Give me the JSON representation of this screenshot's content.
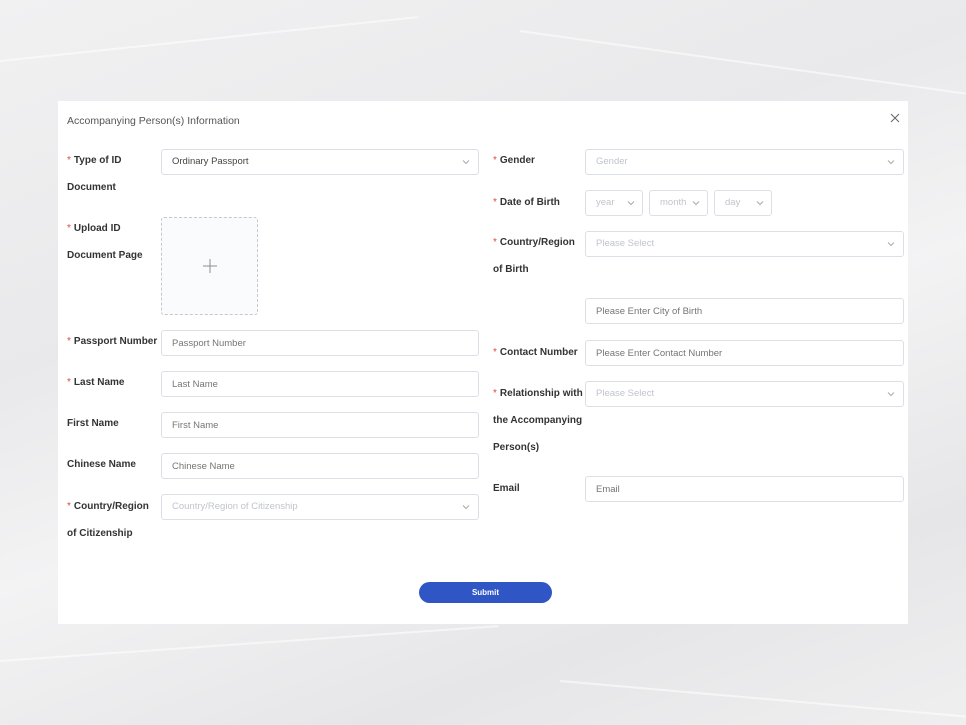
{
  "dialog": {
    "title": "Accompanying Person(s) Information",
    "close_icon": "close-icon"
  },
  "left": {
    "id_type": {
      "label_l1": "Type of ID",
      "label_l2": "Document",
      "value": "Ordinary Passport"
    },
    "upload": {
      "label_l1": "Upload ID",
      "label_l2": "Document Page",
      "icon": "plus-icon"
    },
    "passport_number": {
      "label": "Passport Number",
      "placeholder": "Passport Number"
    },
    "last_name": {
      "label": "Last Name",
      "placeholder": "Last Name"
    },
    "first_name": {
      "label": "First Name",
      "placeholder": "First Name"
    },
    "chinese_name": {
      "label": "Chinese Name",
      "placeholder": "Chinese Name"
    },
    "citizenship": {
      "label_l1": "Country/Region",
      "label_l2": "of Citizenship",
      "placeholder": "Country/Region of Citizenship"
    }
  },
  "right": {
    "gender": {
      "label": "Gender",
      "placeholder": "Gender"
    },
    "dob": {
      "label": "Date of Birth",
      "year": "year",
      "month": "month",
      "day": "day"
    },
    "birth_country": {
      "label_l1": "Country/Region",
      "label_l2": "of Birth",
      "placeholder": "Please Select"
    },
    "birth_city": {
      "placeholder": "Please Enter City of Birth"
    },
    "contact": {
      "label": "Contact Number",
      "placeholder": "Please Enter Contact Number"
    },
    "relationship": {
      "label_l1": "Relationship with",
      "label_l2": "the Accompanying",
      "label_l3": "Person(s)",
      "placeholder": "Please Select"
    },
    "email": {
      "label": "Email",
      "placeholder": "Email"
    }
  },
  "required_mark": "*",
  "submit_label": "Submit",
  "colors": {
    "primary": "#2f56c4",
    "required": "#e5463b",
    "border": "#dcdfe6"
  }
}
